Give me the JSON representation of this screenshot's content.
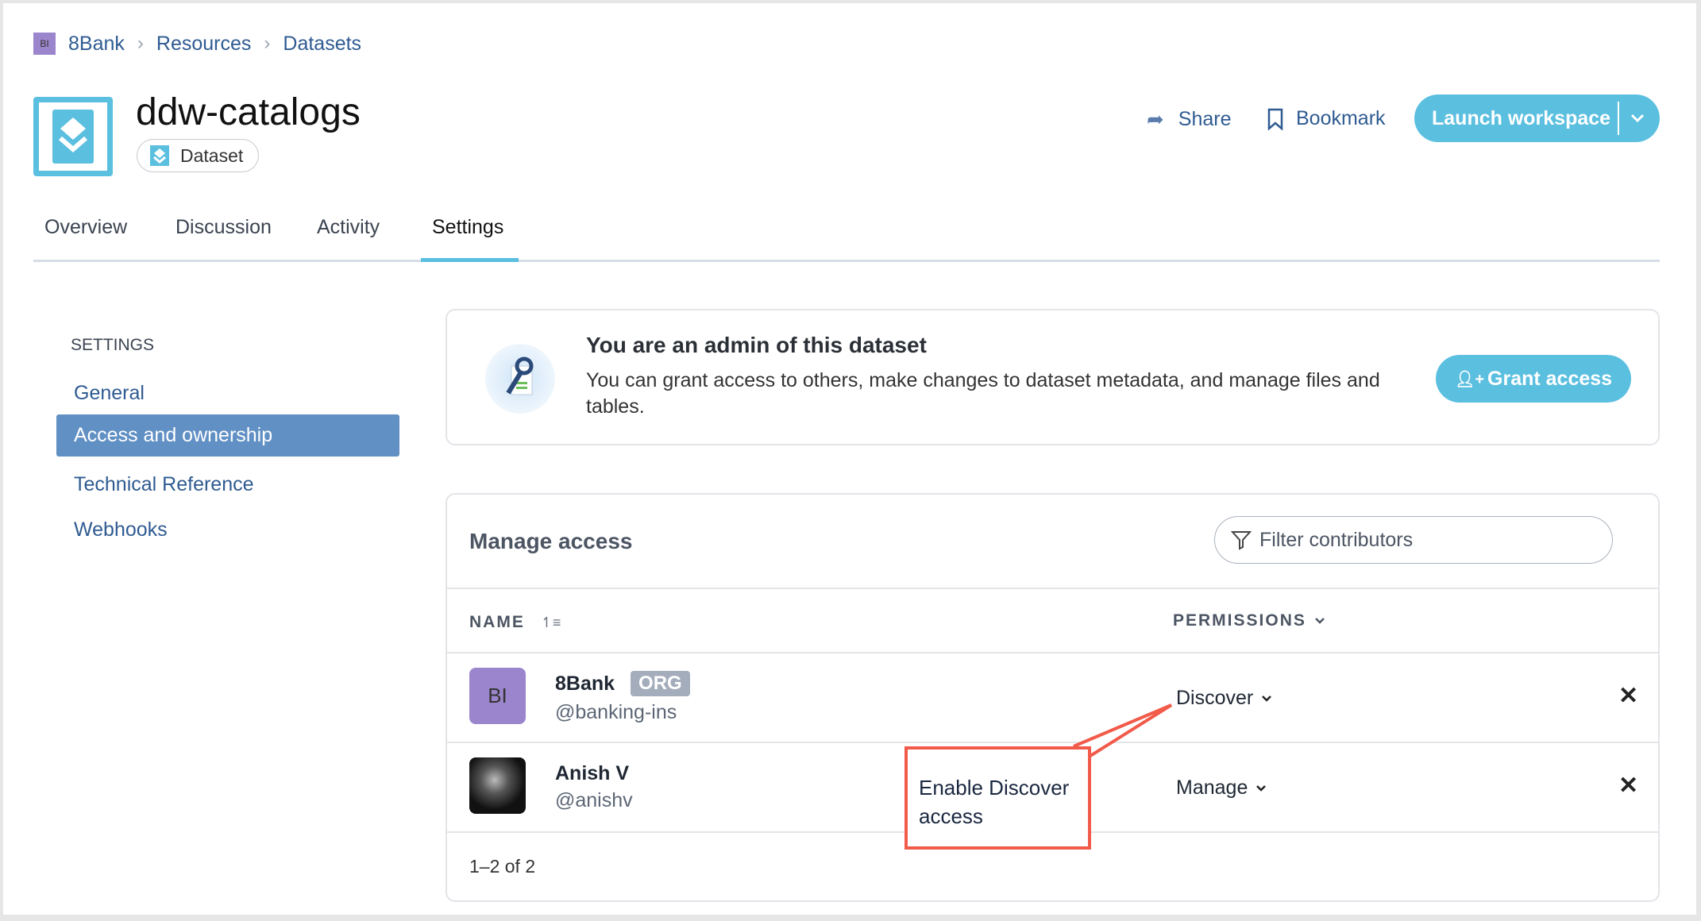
{
  "breadcrumb": {
    "org_initials": "BI",
    "items": [
      "8Bank",
      "Resources",
      "Datasets"
    ]
  },
  "header": {
    "title": "ddw-catalogs",
    "type_badge": "Dataset",
    "share": "Share",
    "bookmark": "Bookmark",
    "launch": "Launch workspace"
  },
  "tabs": [
    {
      "label": "Overview"
    },
    {
      "label": "Discussion"
    },
    {
      "label": "Activity"
    },
    {
      "label": "Settings",
      "active": true
    }
  ],
  "sidebar": {
    "heading": "SETTINGS",
    "items": [
      {
        "label": "General"
      },
      {
        "label": "Access and ownership",
        "active": true
      },
      {
        "label": "Technical Reference"
      },
      {
        "label": "Webhooks"
      }
    ]
  },
  "admin_card": {
    "title": "You are an admin of this dataset",
    "desc": "You can grant access to others, make changes to dataset metadata, and manage files and tables.",
    "grant_button": "Grant access"
  },
  "manage": {
    "title": "Manage access",
    "filter_placeholder": "Filter contributors",
    "col_name": "NAME",
    "col_permissions": "PERMISSIONS",
    "rows": [
      {
        "initials": "BI",
        "name": "8Bank",
        "badge": "ORG",
        "handle": "@banking-ins",
        "permission": "Discover"
      },
      {
        "name": "Anish V",
        "handle": "@anishv",
        "permission": "Manage"
      }
    ],
    "pagination": "1–2 of 2"
  },
  "annotation": {
    "text": "Enable Discover access",
    "color": "#f25a4a"
  },
  "colors": {
    "accent": "#5bbfe0",
    "link": "#2f5b92",
    "sidebar_active": "#6190c4",
    "org_avatar": "#9b85cc"
  }
}
